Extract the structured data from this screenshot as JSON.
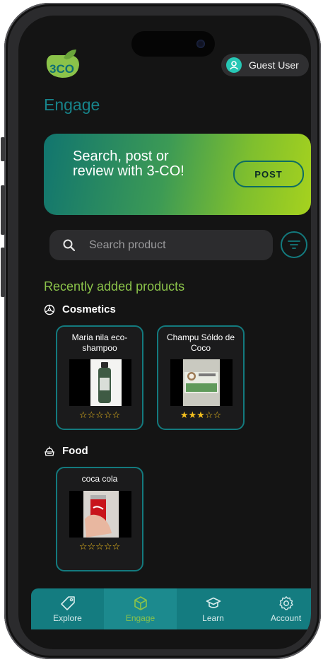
{
  "header": {
    "user_name": "Guest User"
  },
  "page": {
    "title": "Engage"
  },
  "banner": {
    "text": "Search, post or review with 3-CO!",
    "button_label": "POST"
  },
  "search": {
    "placeholder": "Search product"
  },
  "recent": {
    "title": "Recently added products",
    "categories": [
      {
        "label": "Cosmetics",
        "products": [
          {
            "name": "Maria nila eco-shampoo",
            "rating": 0,
            "stars": "☆☆☆☆☆"
          },
          {
            "name": "Champu Sóldo de Coco",
            "rating": 3,
            "stars": "★★★☆☆"
          }
        ]
      },
      {
        "label": "Food",
        "products": [
          {
            "name": "coca cola",
            "rating": 0,
            "stars": "☆☆☆☆☆"
          }
        ]
      }
    ]
  },
  "nav": {
    "items": [
      {
        "label": "Explore",
        "icon": "tag-icon"
      },
      {
        "label": "Engage",
        "icon": "cube-icon",
        "active": true
      },
      {
        "label": "Learn",
        "icon": "graduation-cap-icon"
      },
      {
        "label": "Account",
        "icon": "gear-icon"
      }
    ]
  },
  "colors": {
    "accent_teal": "#147c80",
    "accent_green": "#8bc34a",
    "star": "#f4c01e",
    "background": "#141414"
  }
}
